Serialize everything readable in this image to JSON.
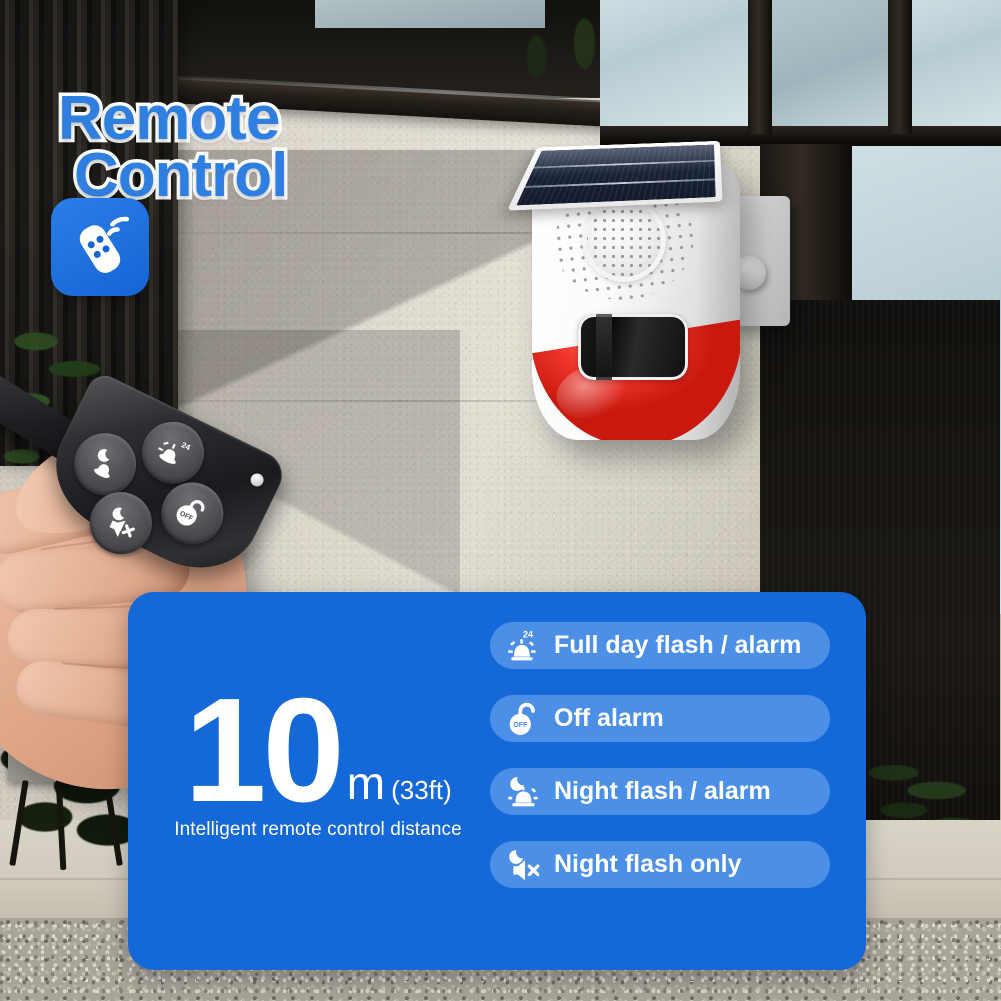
{
  "headline": {
    "line1": "Remote",
    "line2": "Control"
  },
  "badge": {
    "icon": "remote-control-icon",
    "color": "#1565d4"
  },
  "panel": {
    "background_color": "#1568d8",
    "pill_color": "#4b8fe6",
    "distance": {
      "value": "10",
      "unit": "m",
      "alt_unit": "(33ft)",
      "caption": "Intelligent remote control distance"
    },
    "features": [
      {
        "icon": "siren-24h-icon",
        "label": "Full day flash / alarm"
      },
      {
        "icon": "unlocked-off-icon",
        "label": "Off alarm"
      },
      {
        "icon": "moon-siren-icon",
        "label": "Night flash / alarm"
      },
      {
        "icon": "moon-mute-icon",
        "label": "Night flash only"
      }
    ]
  },
  "product": {
    "name": "solar-siren-alarm",
    "parts": {
      "solar_panel": "solar-panel",
      "speaker": "speaker-grille",
      "sensor": "pir-sensor-window",
      "dome": "red-siren-dome",
      "mount": "wall-mount-bracket"
    }
  },
  "remote": {
    "name": "handheld-remote",
    "buttons": [
      {
        "icon": "siren-24h-icon",
        "position": "top"
      },
      {
        "icon": "moon-siren-icon",
        "position": "left"
      },
      {
        "icon": "unlocked-off-icon",
        "position": "right"
      },
      {
        "icon": "moon-mute-icon",
        "position": "bottom"
      }
    ],
    "led": "status-led"
  },
  "scene": {
    "background": "outdoor-house-wall"
  }
}
